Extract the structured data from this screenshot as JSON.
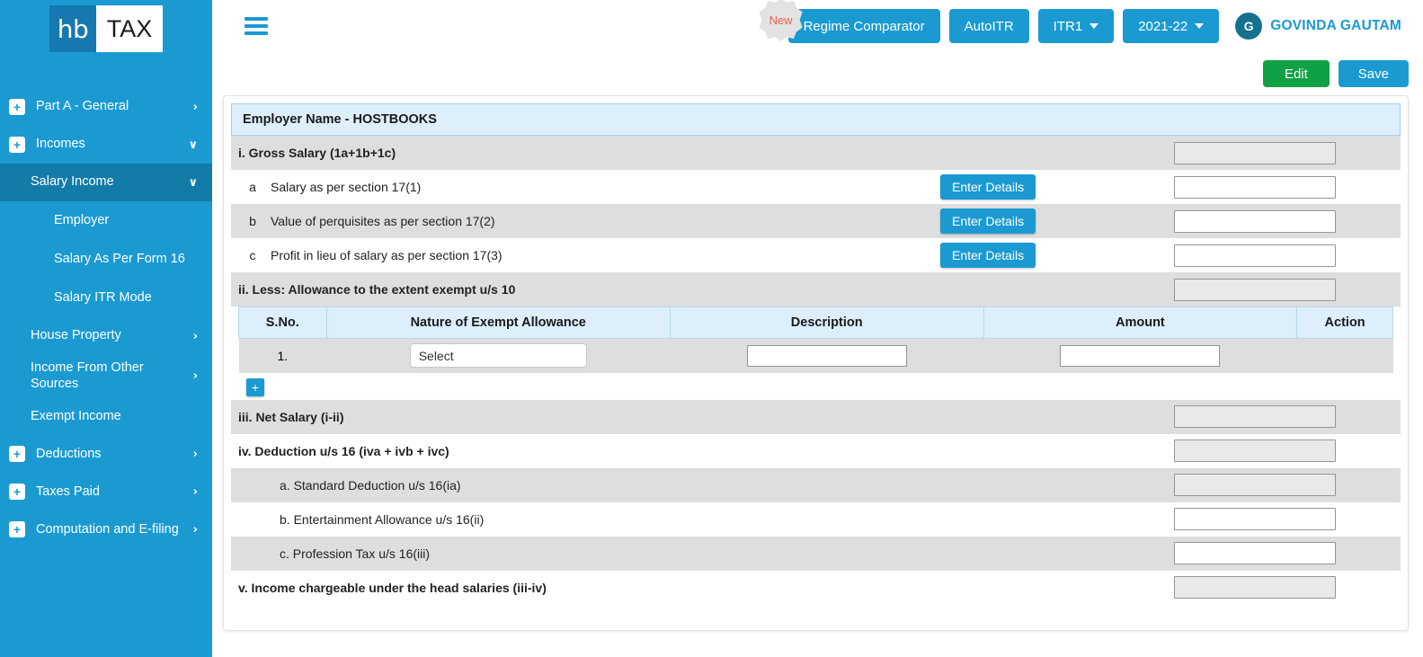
{
  "brand": {
    "logo_left": "hb",
    "logo_right": "TAX",
    "accent": "#1b9ad2",
    "accent_dark": "#127ba8"
  },
  "sidebar": {
    "items": [
      {
        "label": "Part A - General",
        "icon": "plus-box-icon",
        "chevron": "›",
        "has_plus": true,
        "level": 1,
        "active": false
      },
      {
        "label": "Incomes",
        "icon": "plus-box-icon",
        "chevron": "∨",
        "has_plus": true,
        "level": 1,
        "active": false
      },
      {
        "label": "Salary Income",
        "chevron": "∨",
        "has_plus": false,
        "level": 2,
        "active": true
      },
      {
        "label": "Employer",
        "has_plus": false,
        "level": 3,
        "active": false
      },
      {
        "label": "Salary As Per Form 16",
        "has_plus": false,
        "level": 3,
        "active": false
      },
      {
        "label": "Salary ITR Mode",
        "has_plus": false,
        "level": 3,
        "active": false
      },
      {
        "label": "House Property",
        "chevron": "›",
        "has_plus": false,
        "level": 2,
        "active": false
      },
      {
        "label": "Income From Other Sources",
        "chevron": "›",
        "has_plus": false,
        "level": 2,
        "active": false
      },
      {
        "label": "Exempt Income",
        "has_plus": false,
        "level": 2,
        "active": false
      },
      {
        "label": "Deductions",
        "icon": "plus-box-icon",
        "chevron": "›",
        "has_plus": true,
        "level": 1,
        "active": false
      },
      {
        "label": "Taxes Paid",
        "icon": "plus-box-icon",
        "chevron": "›",
        "has_plus": true,
        "level": 1,
        "active": false
      },
      {
        "label": "Computation and E-filing",
        "icon": "plus-box-icon",
        "chevron": "›",
        "has_plus": true,
        "level": 1,
        "active": false
      }
    ]
  },
  "topbar": {
    "menu_icon": "hamburger-icon",
    "new_badge": "New",
    "regime_comparator": "Regime Comparator",
    "auto_itr": "AutoITR",
    "itr_select": "ITR1",
    "year_select": "2021-22",
    "avatar_initial": "G",
    "user_name": "GOVINDA GAUTAM"
  },
  "actions": {
    "edit": "Edit",
    "save": "Save"
  },
  "form": {
    "employer_header": "Employer Name - HOSTBOOKS",
    "rows": [
      {
        "label": "i. Gross Salary (1a+1b+1c)",
        "bold": true,
        "shade": true,
        "indent": "none",
        "letter": "",
        "button": "",
        "input": {
          "value": "",
          "disabled": true
        }
      },
      {
        "label": "Salary as per section 17(1)",
        "bold": false,
        "shade": false,
        "indent": "letter",
        "letter": "a",
        "button": "Enter Details",
        "input": {
          "value": "",
          "disabled": false
        }
      },
      {
        "label": "Value of perquisites as per section 17(2)",
        "bold": false,
        "shade": true,
        "indent": "letter",
        "letter": "b",
        "button": "Enter Details",
        "input": {
          "value": "",
          "disabled": false
        }
      },
      {
        "label": "Profit in lieu of salary as per section 17(3)",
        "bold": false,
        "shade": false,
        "indent": "letter",
        "letter": "c",
        "button": "Enter Details",
        "input": {
          "value": "",
          "disabled": false
        }
      },
      {
        "label": "ii. Less: Allowance to the extent exempt u/s 10",
        "bold": true,
        "shade": true,
        "indent": "none",
        "letter": "",
        "button": "",
        "input": {
          "value": "",
          "disabled": true
        }
      }
    ],
    "exempt_table": {
      "columns": [
        "S.No.",
        "Nature of Exempt Allowance",
        "Description",
        "Amount",
        "Action"
      ],
      "rows": [
        {
          "sno": "1.",
          "nature": "Select",
          "description": "",
          "amount": "",
          "action": ""
        }
      ],
      "add_button": "+"
    },
    "rows_after": [
      {
        "label": "iii. Net Salary (i-ii)",
        "bold": true,
        "shade": true,
        "indent": "none",
        "input": {
          "value": "",
          "disabled": true
        }
      },
      {
        "label": "iv. Deduction u/s 16 (iva + ivb + ivc)",
        "bold": true,
        "shade": false,
        "indent": "none",
        "input": {
          "value": "",
          "disabled": true
        }
      },
      {
        "label": "a. Standard Deduction u/s 16(ia)",
        "bold": false,
        "shade": true,
        "indent": "deep",
        "input": {
          "value": "",
          "disabled": true
        }
      },
      {
        "label": "b. Entertainment Allowance u/s 16(ii)",
        "bold": false,
        "shade": false,
        "indent": "deep",
        "input": {
          "value": "",
          "disabled": false
        }
      },
      {
        "label": "c. Profession Tax u/s 16(iii)",
        "bold": false,
        "shade": true,
        "indent": "deep",
        "input": {
          "value": "",
          "disabled": false
        }
      },
      {
        "label": "v. Income chargeable under the head salaries (iii-iv)",
        "bold": true,
        "shade": false,
        "indent": "none",
        "input": {
          "value": "",
          "disabled": true
        }
      }
    ]
  }
}
